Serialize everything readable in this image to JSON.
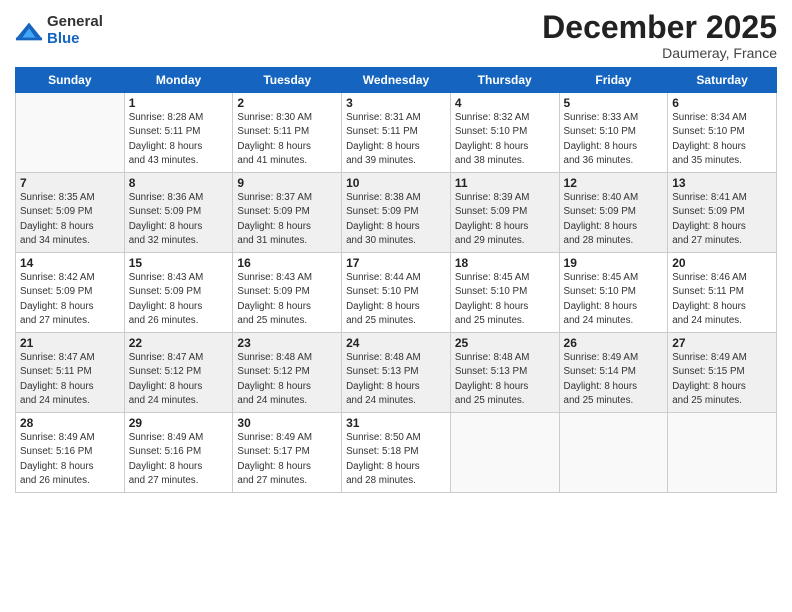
{
  "header": {
    "logo_general": "General",
    "logo_blue": "Blue",
    "month_title": "December 2025",
    "subtitle": "Daumeray, France"
  },
  "weekdays": [
    "Sunday",
    "Monday",
    "Tuesday",
    "Wednesday",
    "Thursday",
    "Friday",
    "Saturday"
  ],
  "weeks": [
    [
      {
        "day": "",
        "detail": ""
      },
      {
        "day": "1",
        "detail": "Sunrise: 8:28 AM\nSunset: 5:11 PM\nDaylight: 8 hours\nand 43 minutes."
      },
      {
        "day": "2",
        "detail": "Sunrise: 8:30 AM\nSunset: 5:11 PM\nDaylight: 8 hours\nand 41 minutes."
      },
      {
        "day": "3",
        "detail": "Sunrise: 8:31 AM\nSunset: 5:11 PM\nDaylight: 8 hours\nand 39 minutes."
      },
      {
        "day": "4",
        "detail": "Sunrise: 8:32 AM\nSunset: 5:10 PM\nDaylight: 8 hours\nand 38 minutes."
      },
      {
        "day": "5",
        "detail": "Sunrise: 8:33 AM\nSunset: 5:10 PM\nDaylight: 8 hours\nand 36 minutes."
      },
      {
        "day": "6",
        "detail": "Sunrise: 8:34 AM\nSunset: 5:10 PM\nDaylight: 8 hours\nand 35 minutes."
      }
    ],
    [
      {
        "day": "7",
        "detail": "Sunrise: 8:35 AM\nSunset: 5:09 PM\nDaylight: 8 hours\nand 34 minutes."
      },
      {
        "day": "8",
        "detail": "Sunrise: 8:36 AM\nSunset: 5:09 PM\nDaylight: 8 hours\nand 32 minutes."
      },
      {
        "day": "9",
        "detail": "Sunrise: 8:37 AM\nSunset: 5:09 PM\nDaylight: 8 hours\nand 31 minutes."
      },
      {
        "day": "10",
        "detail": "Sunrise: 8:38 AM\nSunset: 5:09 PM\nDaylight: 8 hours\nand 30 minutes."
      },
      {
        "day": "11",
        "detail": "Sunrise: 8:39 AM\nSunset: 5:09 PM\nDaylight: 8 hours\nand 29 minutes."
      },
      {
        "day": "12",
        "detail": "Sunrise: 8:40 AM\nSunset: 5:09 PM\nDaylight: 8 hours\nand 28 minutes."
      },
      {
        "day": "13",
        "detail": "Sunrise: 8:41 AM\nSunset: 5:09 PM\nDaylight: 8 hours\nand 27 minutes."
      }
    ],
    [
      {
        "day": "14",
        "detail": "Sunrise: 8:42 AM\nSunset: 5:09 PM\nDaylight: 8 hours\nand 27 minutes."
      },
      {
        "day": "15",
        "detail": "Sunrise: 8:43 AM\nSunset: 5:09 PM\nDaylight: 8 hours\nand 26 minutes."
      },
      {
        "day": "16",
        "detail": "Sunrise: 8:43 AM\nSunset: 5:09 PM\nDaylight: 8 hours\nand 25 minutes."
      },
      {
        "day": "17",
        "detail": "Sunrise: 8:44 AM\nSunset: 5:10 PM\nDaylight: 8 hours\nand 25 minutes."
      },
      {
        "day": "18",
        "detail": "Sunrise: 8:45 AM\nSunset: 5:10 PM\nDaylight: 8 hours\nand 25 minutes."
      },
      {
        "day": "19",
        "detail": "Sunrise: 8:45 AM\nSunset: 5:10 PM\nDaylight: 8 hours\nand 24 minutes."
      },
      {
        "day": "20",
        "detail": "Sunrise: 8:46 AM\nSunset: 5:11 PM\nDaylight: 8 hours\nand 24 minutes."
      }
    ],
    [
      {
        "day": "21",
        "detail": "Sunrise: 8:47 AM\nSunset: 5:11 PM\nDaylight: 8 hours\nand 24 minutes."
      },
      {
        "day": "22",
        "detail": "Sunrise: 8:47 AM\nSunset: 5:12 PM\nDaylight: 8 hours\nand 24 minutes."
      },
      {
        "day": "23",
        "detail": "Sunrise: 8:48 AM\nSunset: 5:12 PM\nDaylight: 8 hours\nand 24 minutes."
      },
      {
        "day": "24",
        "detail": "Sunrise: 8:48 AM\nSunset: 5:13 PM\nDaylight: 8 hours\nand 24 minutes."
      },
      {
        "day": "25",
        "detail": "Sunrise: 8:48 AM\nSunset: 5:13 PM\nDaylight: 8 hours\nand 25 minutes."
      },
      {
        "day": "26",
        "detail": "Sunrise: 8:49 AM\nSunset: 5:14 PM\nDaylight: 8 hours\nand 25 minutes."
      },
      {
        "day": "27",
        "detail": "Sunrise: 8:49 AM\nSunset: 5:15 PM\nDaylight: 8 hours\nand 25 minutes."
      }
    ],
    [
      {
        "day": "28",
        "detail": "Sunrise: 8:49 AM\nSunset: 5:16 PM\nDaylight: 8 hours\nand 26 minutes."
      },
      {
        "day": "29",
        "detail": "Sunrise: 8:49 AM\nSunset: 5:16 PM\nDaylight: 8 hours\nand 27 minutes."
      },
      {
        "day": "30",
        "detail": "Sunrise: 8:49 AM\nSunset: 5:17 PM\nDaylight: 8 hours\nand 27 minutes."
      },
      {
        "day": "31",
        "detail": "Sunrise: 8:50 AM\nSunset: 5:18 PM\nDaylight: 8 hours\nand 28 minutes."
      },
      {
        "day": "",
        "detail": ""
      },
      {
        "day": "",
        "detail": ""
      },
      {
        "day": "",
        "detail": ""
      }
    ]
  ]
}
